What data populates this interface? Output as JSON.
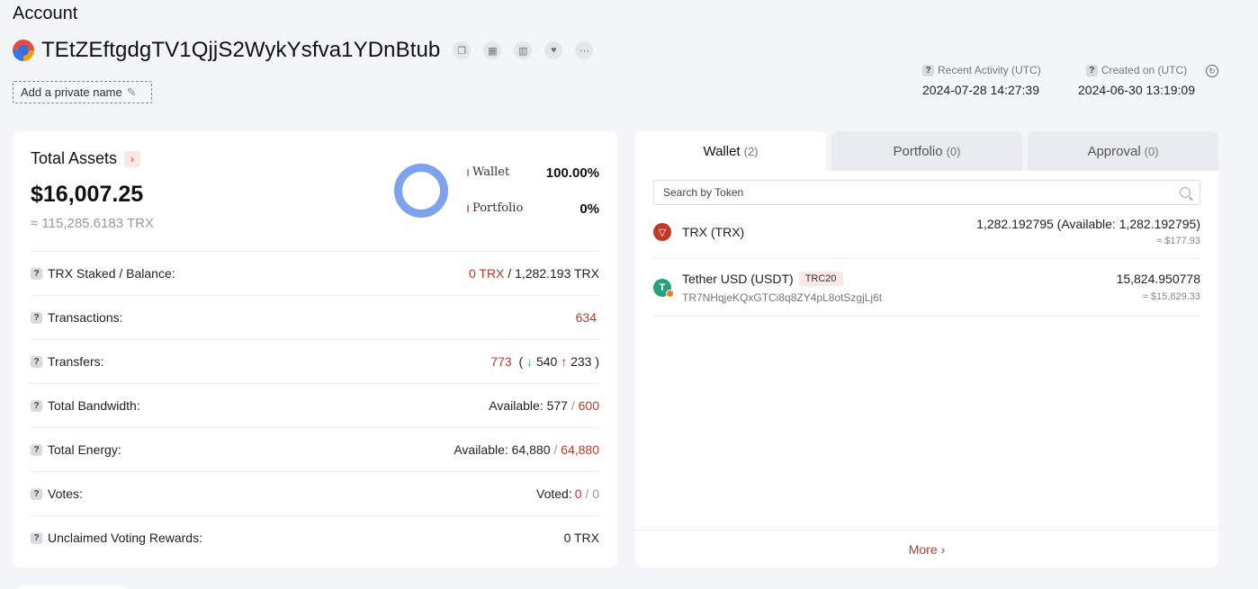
{
  "header": {
    "title": "Account",
    "address": "TEtZEftgdgTV1QjjS2WykYsfva1YDnBtub",
    "private_name_label": "Add a private name",
    "recent_activity_label": "Recent Activity (UTC)",
    "recent_activity_value": "2024-07-28 14:27:39",
    "created_on_label": "Created on (UTC)",
    "created_on_value": "2024-06-30 13:19:09"
  },
  "assets": {
    "title": "Total Assets",
    "value_usd": "$16,007.25",
    "value_trx": "≈ 115,285.6183 TRX",
    "legend": [
      {
        "name": "Wallet",
        "pct": "100.00%",
        "color": "#7fa2ef"
      },
      {
        "name": "Portfolio",
        "pct": "0%",
        "color": "#e07a6b"
      }
    ],
    "rows": {
      "staked": {
        "label": "TRX Staked / Balance:",
        "staked": "0 TRX",
        "sep": " / ",
        "balance": "1,282.193 TRX"
      },
      "transactions": {
        "label": "Transactions:",
        "value": "634"
      },
      "transfers": {
        "label": "Transfers:",
        "total": "773",
        "open": "(",
        "in": "540",
        "out": "233",
        "close": ")"
      },
      "bandwidth": {
        "label": "Total Bandwidth:",
        "prefix": "Available: 577",
        "sep": " / ",
        "total": "600"
      },
      "energy": {
        "label": "Total Energy:",
        "prefix": "Available: 64,880",
        "sep": " / ",
        "total": "64,880"
      },
      "votes": {
        "label": "Votes:",
        "prefix": "Voted:",
        "used": "0",
        "sep": " / ",
        "total": "0"
      },
      "rewards": {
        "label": "Unclaimed Voting Rewards:",
        "value": "0 TRX"
      }
    }
  },
  "tabs": [
    {
      "label": "Wallet",
      "count": "(2)"
    },
    {
      "label": "Portfolio",
      "count": "(0)"
    },
    {
      "label": "Approval",
      "count": "(0)"
    }
  ],
  "wallet": {
    "search_placeholder": "Search by Token",
    "tokens": [
      {
        "name": "TRX (TRX)",
        "amount": "1,282.192795 (Available: 1,282.192795)",
        "usd": "≈ $177.93"
      },
      {
        "name": "Tether USD (USDT)",
        "badge": "TRC20",
        "contract": "TR7NHqjeKQxGTCi8q8ZY4pL8otSzgjLj6t",
        "amount": "15,824.950778",
        "usd": "≈ $15,829.33"
      }
    ],
    "more_label": "More"
  }
}
